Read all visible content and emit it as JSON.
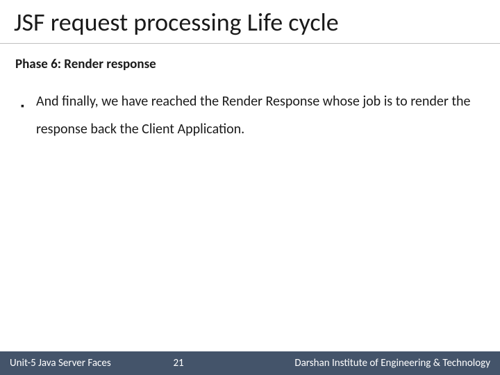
{
  "title": "JSF request processing Life cycle",
  "subhead": "Phase 6: Render response",
  "bullets": [
    "And finally, we have reached the Render Response whose job is to render the response back the Client Application."
  ],
  "footer": {
    "left": "Unit-5 Java Server Faces",
    "page": "21",
    "right": "Darshan Institute of Engineering & Technology"
  }
}
